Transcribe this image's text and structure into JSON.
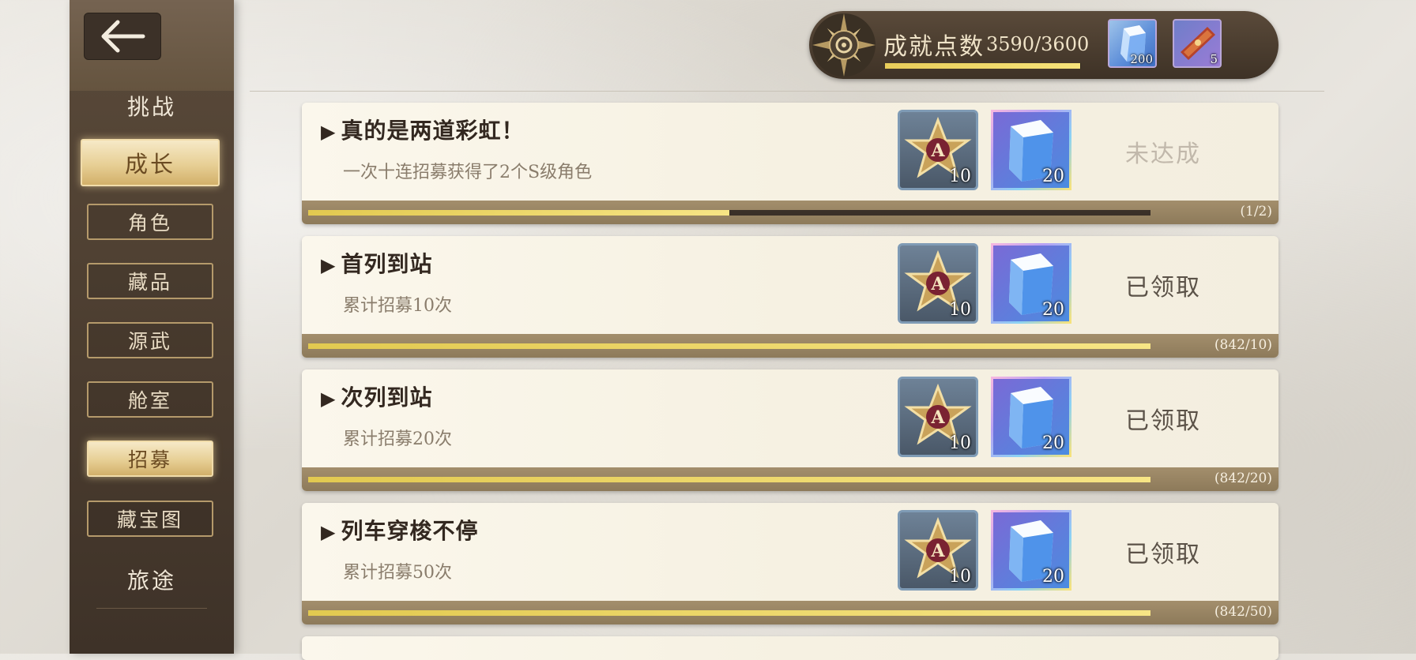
{
  "sidebar": {
    "back_label": "←",
    "category_challenge": "挑战",
    "category_journey": "旅途",
    "items": [
      {
        "label": "成长",
        "active": true
      },
      {
        "label": "角色",
        "active": false
      },
      {
        "label": "藏品",
        "active": false
      },
      {
        "label": "源武",
        "active": false
      },
      {
        "label": "舱室",
        "active": false
      },
      {
        "label": "招募",
        "active": true
      },
      {
        "label": "藏宝图",
        "active": false
      }
    ]
  },
  "header": {
    "label": "成就点数",
    "points": "3590/3600",
    "progress": 0.997,
    "resources": [
      {
        "icon": "crystal-icon",
        "count": "200"
      },
      {
        "icon": "ticket-icon",
        "count": "5"
      }
    ]
  },
  "achievements": [
    {
      "title": "真的是两道彩虹！",
      "desc": "一次十连招募获得了2个S级角色",
      "rewards": [
        {
          "icon": "a-star-badge-icon",
          "count": "10"
        },
        {
          "icon": "crystal-icon",
          "count": "20"
        }
      ],
      "status": "未达成",
      "claimed": false,
      "progress_text": "(1/2)",
      "progress": 0.5
    },
    {
      "title": "首列到站",
      "desc": "累计招募10次",
      "rewards": [
        {
          "icon": "a-star-badge-icon",
          "count": "10"
        },
        {
          "icon": "crystal-icon",
          "count": "20"
        }
      ],
      "status": "已领取",
      "claimed": true,
      "progress_text": "(842/10)",
      "progress": 1.0
    },
    {
      "title": "次列到站",
      "desc": "累计招募20次",
      "rewards": [
        {
          "icon": "a-star-badge-icon",
          "count": "10"
        },
        {
          "icon": "crystal-icon",
          "count": "20"
        }
      ],
      "status": "已领取",
      "claimed": true,
      "progress_text": "(842/20)",
      "progress": 1.0
    },
    {
      "title": "列车穿梭不停",
      "desc": "累计招募50次",
      "rewards": [
        {
          "icon": "a-star-badge-icon",
          "count": "10"
        },
        {
          "icon": "crystal-icon",
          "count": "20"
        }
      ],
      "status": "已领取",
      "claimed": true,
      "progress_text": "(842/50)",
      "progress": 1.0
    }
  ],
  "colors": {
    "accent_gold": "#e9cd5a",
    "sidebar_bg": "#4a3c2f",
    "card_bg": "#f8f4e8"
  }
}
